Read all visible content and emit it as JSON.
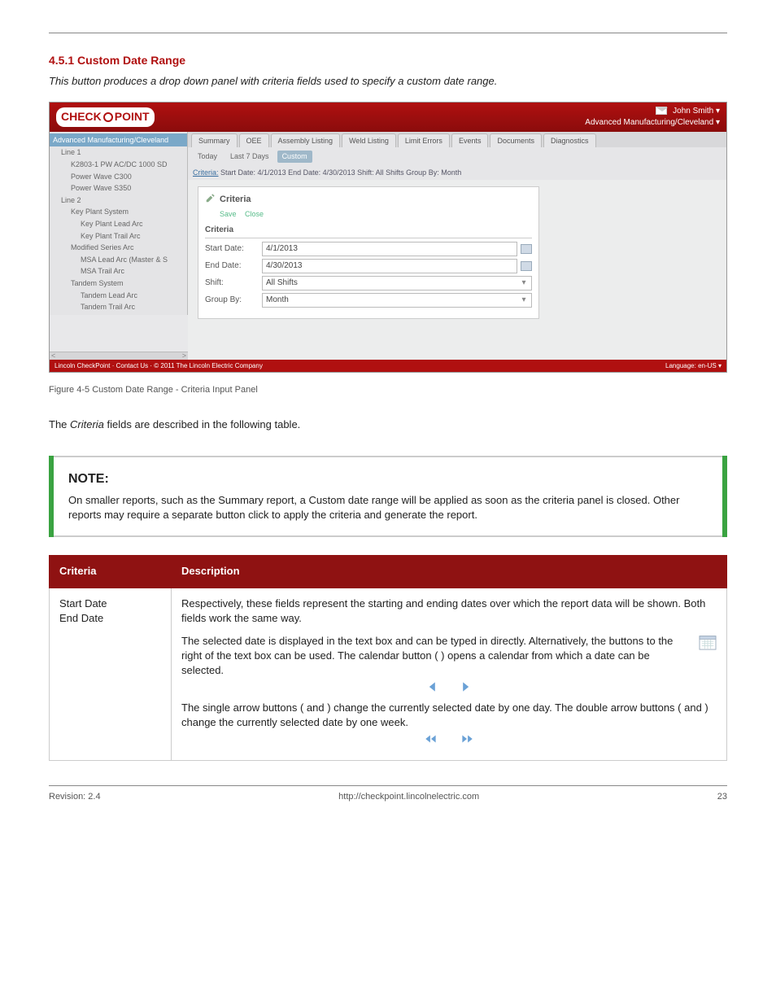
{
  "section": {
    "num": "4.5.1",
    "title": "Custom Date Range"
  },
  "intro": "This button produces a drop down panel with criteria fields used to specify a custom date range.",
  "screenshot": {
    "logo": "CHECK POINT",
    "user": {
      "name": "John Smith",
      "company": "Advanced Manufacturing/Cleveland"
    },
    "tree_top": "Advanced Manufacturing/Cleveland",
    "tree": [
      {
        "l": 1,
        "t": "Line 1"
      },
      {
        "l": 2,
        "t": "K2803-1 PW AC/DC 1000 SD"
      },
      {
        "l": 2,
        "t": "Power Wave C300"
      },
      {
        "l": 2,
        "t": "Power Wave S350"
      },
      {
        "l": 1,
        "t": "Line 2"
      },
      {
        "l": 2,
        "t": "Key Plant System"
      },
      {
        "l": 3,
        "t": "Key Plant Lead Arc"
      },
      {
        "l": 3,
        "t": "Key Plant Trail Arc"
      },
      {
        "l": 2,
        "t": "Modified Series Arc"
      },
      {
        "l": 3,
        "t": "MSA Lead Arc (Master & S"
      },
      {
        "l": 3,
        "t": "MSA Trail Arc"
      },
      {
        "l": 2,
        "t": "Tandem System"
      },
      {
        "l": 3,
        "t": "Tandem Lead Arc"
      },
      {
        "l": 3,
        "t": "Tandem Trail Arc"
      }
    ],
    "tabs": [
      "Summary",
      "OEE",
      "Assembly Listing",
      "Weld Listing",
      "Limit Errors",
      "Events",
      "Documents",
      "Diagnostics"
    ],
    "subtabs": {
      "today": "Today",
      "last7": "Last 7 Days",
      "custom": "Custom"
    },
    "criteria_line": {
      "label": "Criteria:",
      "text": "Start Date: 4/1/2013 End Date: 4/30/2013 Shift: All Shifts Group By: Month"
    },
    "panel": {
      "title": "Criteria",
      "save": "Save",
      "close": "Close",
      "section": "Criteria",
      "start_label": "Start Date:",
      "start": "4/1/2013",
      "end_label": "End Date:",
      "end": "4/30/2013",
      "shift_label": "Shift:",
      "shift": "All Shifts",
      "group_label": "Group By:",
      "group": "Month"
    },
    "footer_left": "Lincoln CheckPoint · Contact Us · © 2011 The Lincoln Electric Company",
    "footer_right": "Language: en-US"
  },
  "caption": "Figure 4-5 Custom Date Range - Criteria Input Panel",
  "note": {
    "heading": "NOTE:",
    "body": "On smaller reports, such as the Summary report, a Custom date range will be applied as soon as the criteria panel is closed. Other reports may require a separate button click to apply the criteria and generate the report."
  },
  "table": {
    "head": {
      "c1": "Criteria",
      "c2": "Description"
    },
    "row1": {
      "c1": "Start Date\nEnd Date",
      "c2": "Respectively, these fields represent the starting and ending dates over which the report data will be shown. Both fields work the same way.",
      "p2": "The selected date is displayed in the text box and can be typed in directly. Alternatively, the buttons to the right of the text box can be used. The calendar button ( ) opens a calendar from which a date can be selected.",
      "p3": "The single arrow buttons (  and  ) change the currently selected date by one day. The double arrow buttons (  and  ) change the currently selected date by one week."
    }
  },
  "footer": {
    "left": "Revision: 2.4",
    "center": "http://checkpoint.lincolnelectric.com",
    "right": "23"
  }
}
